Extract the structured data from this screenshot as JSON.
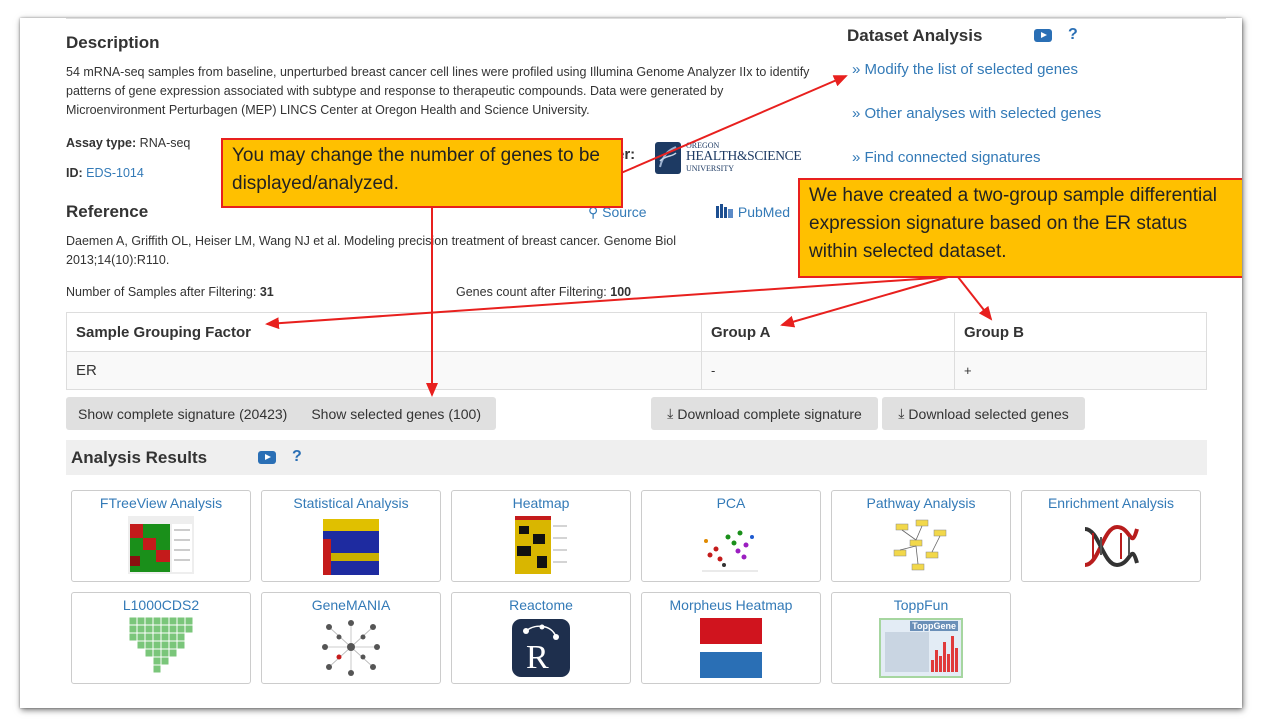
{
  "description": {
    "heading": "Description",
    "text": "54 mRNA-seq samples from baseline, unperturbed breast cancer cell lines were profiled using Illumina Genome Analyzer IIx to identify patterns of gene expression associated with subtype and response to therapeutic compounds. Data were generated by Microenvironment Perturbagen (MEP) LINCS Center at Oregon Health and Science University.",
    "assay_label": "Assay type:",
    "assay_value": "RNA-seq",
    "id_label": "ID:",
    "id_value": "EDS-1014",
    "center_label_fragment": "er:",
    "logo_text_1": "OREGON",
    "logo_text_2": "HEALTH&SCIENCE",
    "logo_text_3": "UNIVERSITY"
  },
  "reference": {
    "heading": "Reference",
    "source_link": "Source",
    "pubmed_link": "PubMed",
    "text": "Daemen A, Griffith OL, Heiser LM, Wang NJ et al. Modeling precision treatment of breast cancer. Genome Biol 2013;14(10):R110."
  },
  "filtering": {
    "samples_label": "Number of Samples after Filtering:",
    "samples_value": "31",
    "genes_label": "Genes count after Filtering:",
    "genes_value": "100"
  },
  "dataset_analysis": {
    "heading": "Dataset Analysis",
    "help": "?",
    "links": [
      "» Modify the list of selected genes",
      "» Other analyses with selected genes",
      "» Find connected signatures"
    ]
  },
  "grouping_table": {
    "headers": [
      "Sample Grouping Factor",
      "Group A",
      "Group B"
    ],
    "row": [
      "ER",
      "-",
      "+"
    ]
  },
  "buttons": {
    "show_complete": "Show complete signature (20423)",
    "show_selected": "Show selected genes (100)",
    "download_complete": "Download complete signature",
    "download_selected": "Download selected genes"
  },
  "analysis_results": {
    "heading": "Analysis Results",
    "help": "?",
    "cards": [
      "FTreeView Analysis",
      "Statistical Analysis",
      "Heatmap",
      "PCA",
      "Pathway Analysis",
      "Enrichment Analysis",
      "L1000CDS2",
      "GeneMANIA",
      "Reactome",
      "Morpheus Heatmap",
      "ToppFun"
    ],
    "toppgene_label": "ToppGene",
    "reactome_letter": "R"
  },
  "callouts": {
    "genes": "You may change the number of genes to be displayed/analyzed.",
    "signature": "We have created a two-group sample differential expression signature based on the ER status within selected dataset."
  },
  "colors": {
    "link": "#337ab7",
    "callout_fill": "#ffc000",
    "callout_border": "#e8201e",
    "arrow": "#e8201e"
  }
}
